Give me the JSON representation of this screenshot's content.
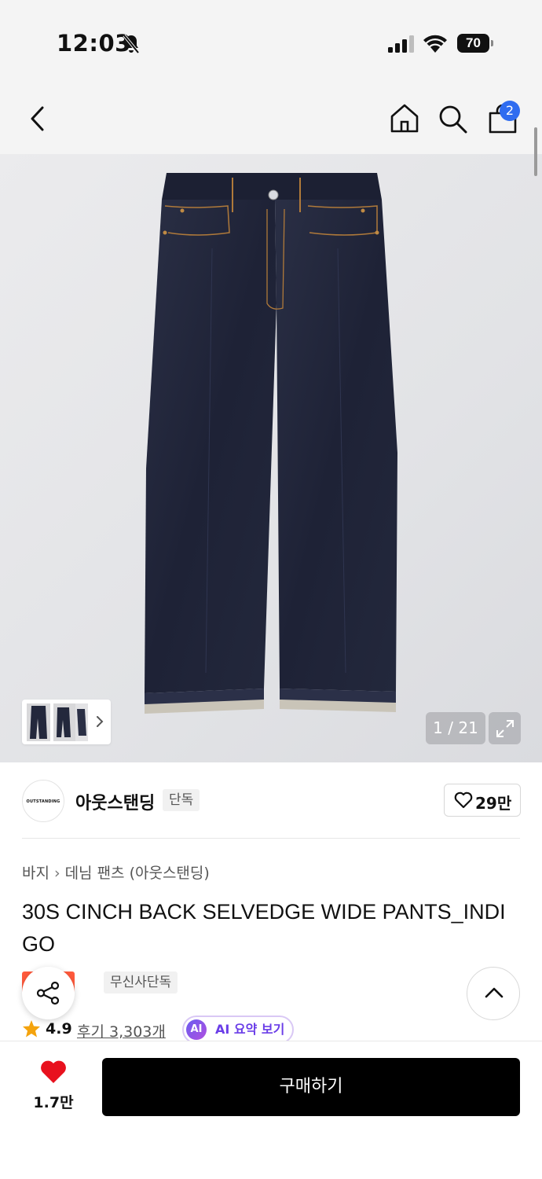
{
  "status_bar": {
    "time": "12:03",
    "battery_level": "70",
    "icons": [
      "bell-slash-icon",
      "cellular-signal-icon",
      "wifi-icon",
      "battery-icon"
    ]
  },
  "nav": {
    "icons": [
      "back-arrow-icon",
      "home-icon",
      "search-icon",
      "shopping-bag-icon"
    ],
    "cart_count": "2"
  },
  "gallery": {
    "counter": "1 / 21",
    "icons": [
      "chevron-right-icon",
      "expand-icon"
    ]
  },
  "brand": {
    "logo_text": "OUTSTANDING",
    "name": "아웃스탠딩",
    "tag": "단독",
    "like_count": "29만",
    "like_icon": "heart-outline-icon"
  },
  "breadcrumb": {
    "category": "바지",
    "subcategory": "데님 팬츠 (아웃스탠딩)"
  },
  "product": {
    "title": "30S CINCH BACK SELVEDGE WIDE PANTS_INDIGO",
    "sale_badge": "세일",
    "exclusive_badge": "무신사단독",
    "rating": "4.9",
    "review_link": "후기 3,303개",
    "ai_badge": "AI",
    "ai_summary": "AI 요약 보기"
  },
  "actions": {
    "share_icon": "share-icon",
    "top_icon": "chevron-up-icon",
    "wish_count": "1.7만",
    "buy_label": "구매하기"
  },
  "colors": {
    "accent_blue": "#2f6cf0",
    "sale_orange": "#ff5a3c",
    "heart_red": "#e8111e",
    "star_orange": "#f4a30d",
    "ai_purple": "#6a3de8"
  }
}
